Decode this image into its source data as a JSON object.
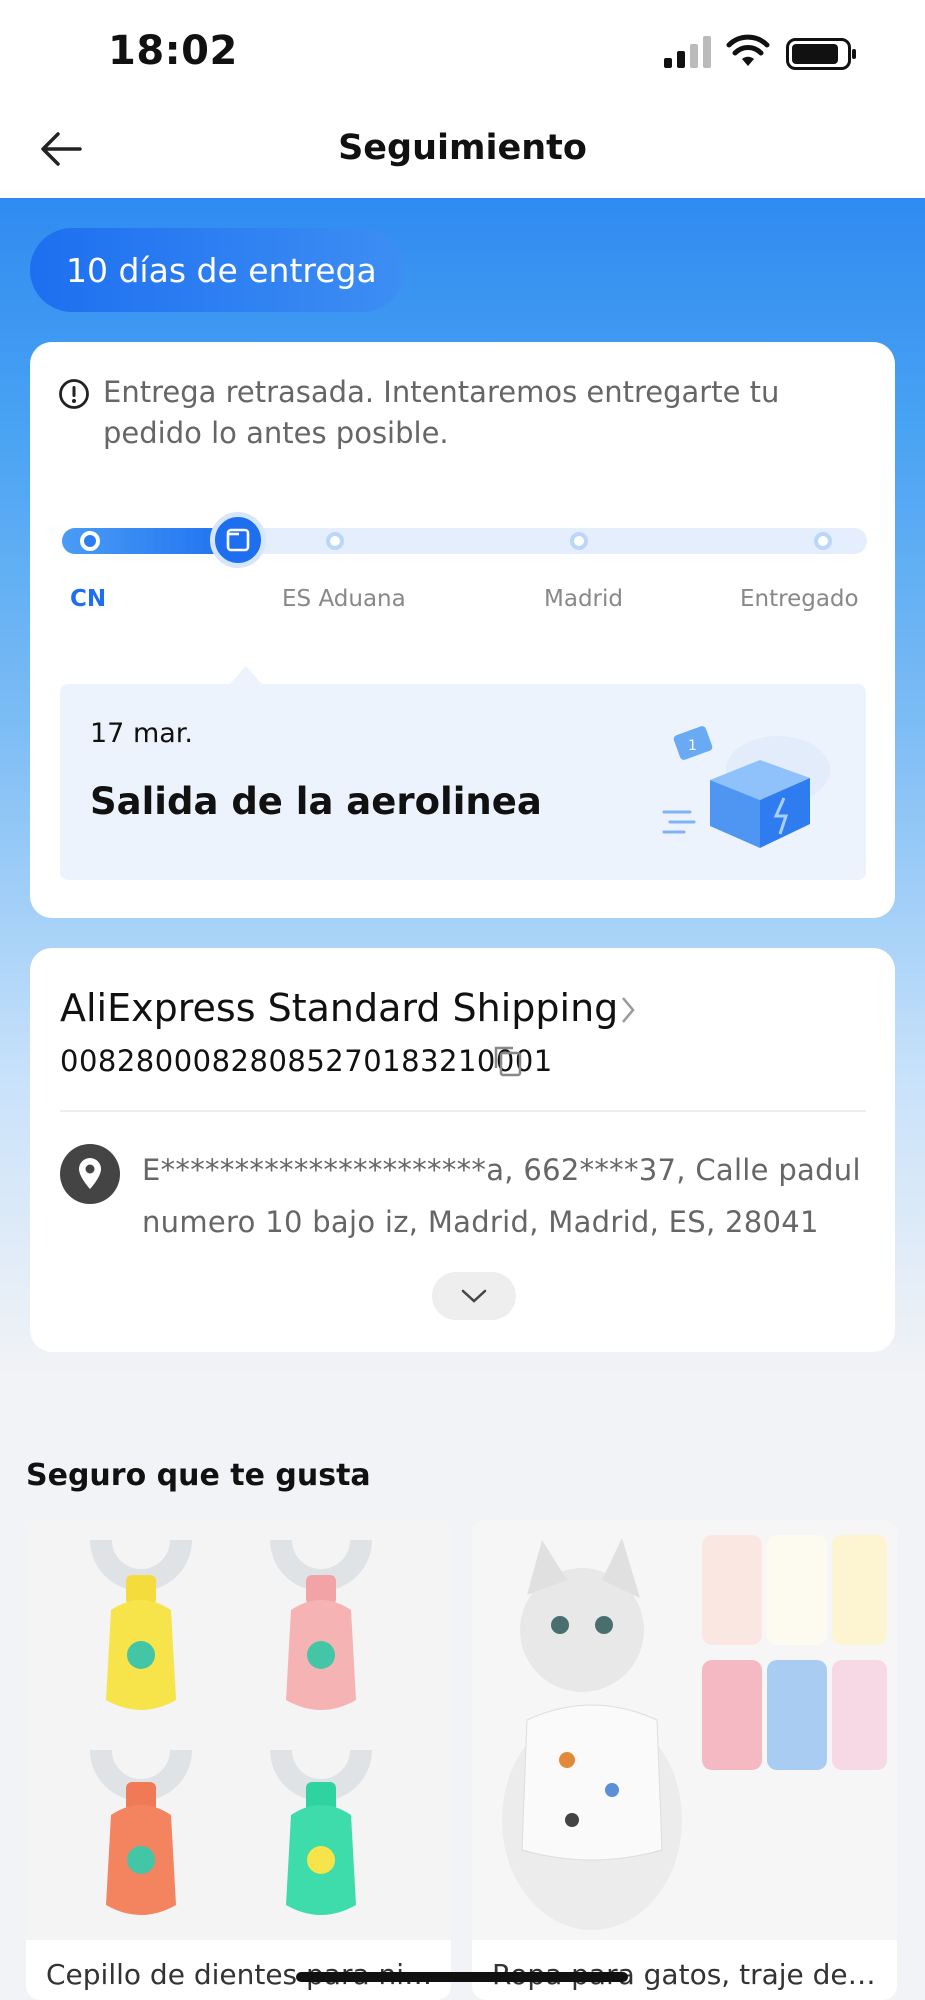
{
  "status_bar": {
    "time": "18:02"
  },
  "nav": {
    "title": "Seguimiento"
  },
  "delivery_pill": "10 días de entrega",
  "alert": {
    "text": "Entrega retrasada. Intentaremos entregarte tu pedido lo antes posible."
  },
  "progress": {
    "current_step": 2,
    "steps": [
      "CN",
      "ES Aduana",
      "Madrid",
      "Entregado"
    ]
  },
  "event": {
    "date": "17 mar.",
    "title": "Salida de la aerolinea"
  },
  "shipping": {
    "carrier": "AliExpress Standard Shipping",
    "tracking_number": "00828000828085270183210001",
    "address": "E**********************a,  662****37,  Calle padul numero 10 bajo iz,  Madrid,  Madrid,  ES,  28041"
  },
  "recommendations": {
    "title": "Seguro que te gusta",
    "items": [
      {
        "title": "Cepillo de dientes para niñ..."
      },
      {
        "title": "Ropa para gatos, traje de ..."
      }
    ]
  },
  "colors": {
    "accent": "#1e6ff0",
    "hero_top": "#2f8bf0"
  }
}
